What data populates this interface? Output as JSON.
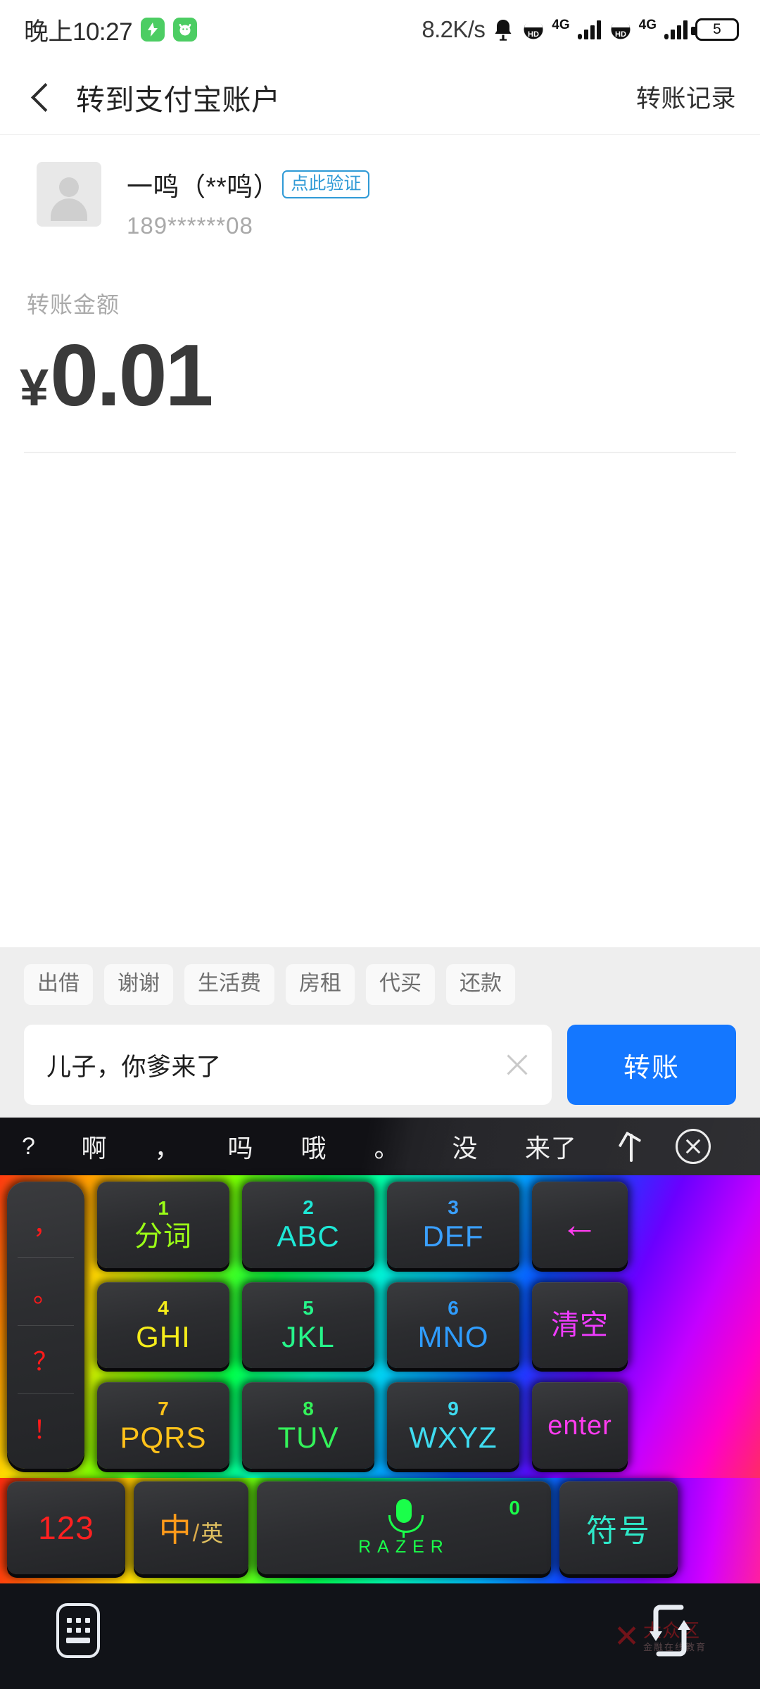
{
  "status_bar": {
    "time": "晚上10:27",
    "badges": [
      "⚡",
      "🤖"
    ],
    "network_speed": "8.2K/s",
    "icons": [
      "bell-icon",
      "volte-hd-icon",
      "signal-icon",
      "volte-hd-icon",
      "signal-icon"
    ],
    "network_type_1": "4G",
    "network_type_2": "4G",
    "battery_level": "5"
  },
  "header": {
    "back_icon": "back-chevron-icon",
    "title": "转到支付宝账户",
    "action": "转账记录"
  },
  "payee": {
    "avatar": "default-user-avatar",
    "name": "一鸣（**鸣）",
    "verify_badge": "点此验证",
    "phone": "189******08"
  },
  "amount": {
    "label": "转账金额",
    "currency": "¥",
    "value": "0.01"
  },
  "compose": {
    "tags": [
      "出借",
      "谢谢",
      "生活费",
      "房租",
      "代买",
      "还款"
    ],
    "message_value": "儿子，你爹来了",
    "clear_icon": "clear-x-icon",
    "send_label": "转账"
  },
  "keyboard": {
    "candidates": [
      "?",
      "啊",
      "，",
      "吗",
      "哦",
      "。",
      "没",
      "来了"
    ],
    "expand_icon": "arrow-up-icon",
    "close_icon": "close-circle-icon",
    "punctuation_keys": [
      "，",
      "。",
      "？",
      "！"
    ],
    "keys": [
      {
        "num": "1",
        "label": "分词",
        "color": "#9bff16"
      },
      {
        "num": "2",
        "label": "ABC",
        "color": "#1ee8d6"
      },
      {
        "num": "3",
        "label": "DEF",
        "color": "#3aa0ff"
      },
      {
        "num": "4",
        "label": "GHI",
        "color": "#f5ec1a"
      },
      {
        "num": "5",
        "label": "JKL",
        "color": "#26f58a"
      },
      {
        "num": "6",
        "label": "MNO",
        "color": "#2f9dff"
      },
      {
        "num": "7",
        "label": "PQRS",
        "color": "#ffc21a"
      },
      {
        "num": "8",
        "label": "TUV",
        "color": "#34f25a"
      },
      {
        "num": "9",
        "label": "WXYZ",
        "color": "#3fdcf0"
      }
    ],
    "backspace_label": "←",
    "clear_label": "清空",
    "enter_label": "enter",
    "func_123": "123",
    "func_lang_cn": "中",
    "func_lang_slash": "/",
    "func_lang_en": "英",
    "space_zero": "0",
    "space_brand": "RAZER",
    "space_mic_icon": "microphone-icon",
    "func_symbol": "符号"
  },
  "nav_bar": {
    "keyboard_switch_icon": "keyboard-switch-icon",
    "rotate_icon": "screen-rotate-icon",
    "watermark_mark": "✕",
    "watermark_line1": "大众区",
    "watermark_line2": "金融在线教育"
  },
  "colors": {
    "accent_blue": "#1477ff",
    "verify_blue": "#2f9ad6",
    "page_bg": "#ffffff",
    "compose_bg": "#eeeeee",
    "keyboard_bg": "#0a0a0d"
  }
}
